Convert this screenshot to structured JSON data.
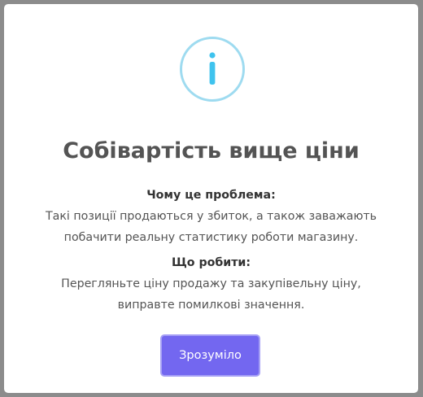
{
  "dialog": {
    "icon": "info-icon",
    "icon_color": "#3fc3ee",
    "icon_ring_color": "#9edbf0",
    "title": "Собівартість вище ціни",
    "why_heading": "Чому це проблема:",
    "why_line1": "Такі позиції продаються у збиток, а також заважають",
    "why_line2": "побачити реальну статистику роботи магазину.",
    "what_heading": "Що робити:",
    "what_line1": "Перегляньте ціну продажу та закупівельну ціну,",
    "what_line2": "виправте помилкові значення.",
    "confirm_label": "Зрозуміло",
    "confirm_color": "#7367f0"
  }
}
